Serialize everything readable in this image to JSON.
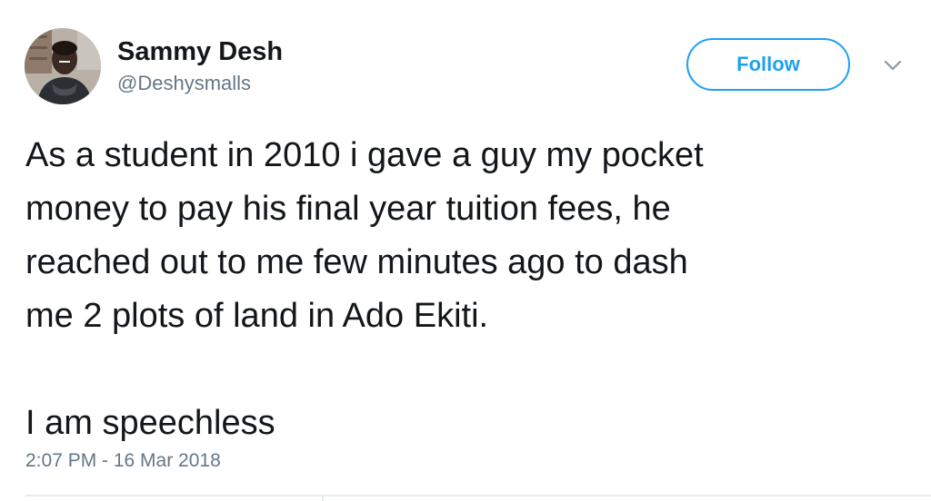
{
  "author": {
    "name": "Sammy Desh",
    "handle": "@Deshysmalls"
  },
  "follow_button": {
    "label": "Follow"
  },
  "menu": {
    "icon": "chevron-down-icon"
  },
  "tweet": {
    "paragraph_1": "As a student in 2010 i gave a guy my pocket\nmoney to pay his final year tuition fees, he\nreached out to me few minutes ago to dash\nme 2 plots of land in Ado Ekiti.",
    "paragraph_2": "I am speechless",
    "timestamp": "2:07 PM - 16 Mar 2018"
  },
  "colors": {
    "accent": "#1da1f2",
    "text": "#14171a",
    "muted": "#657786",
    "divider": "#e6ecf0"
  }
}
